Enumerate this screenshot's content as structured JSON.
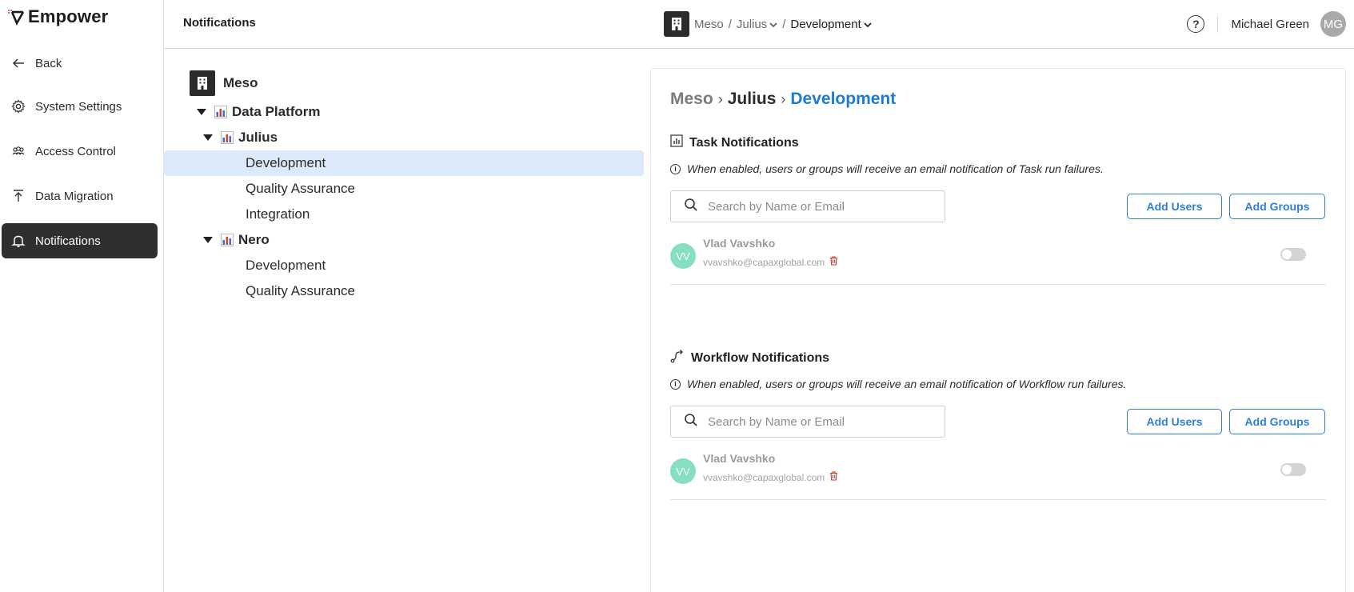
{
  "app": {
    "name": "Empower",
    "brand_color": "#2f2f2f",
    "accent_color": "#1f7ad1"
  },
  "sidebar": {
    "items": [
      {
        "label": "Back",
        "icon": "arrow-left-icon",
        "active": false
      },
      {
        "label": "System Settings",
        "icon": "gear-icon",
        "active": false
      },
      {
        "label": "Access Control",
        "icon": "people-icon",
        "active": false
      },
      {
        "label": "Data Migration",
        "icon": "upload-icon",
        "active": false
      },
      {
        "label": "Notifications",
        "icon": "bell-icon",
        "active": true
      }
    ]
  },
  "header": {
    "title": "Notifications",
    "crumb": {
      "org": "Meso",
      "sep1": "/",
      "project": "Julius",
      "sep2": "/",
      "env": "Development"
    },
    "user": {
      "name": "Michael Green",
      "initials": "MG"
    }
  },
  "tree": {
    "root": "Meso",
    "nodes": [
      {
        "label": "Data Platform"
      },
      {
        "label": "Julius"
      },
      {
        "label": "Development",
        "selected": true
      },
      {
        "label": "Quality Assurance"
      },
      {
        "label": "Integration"
      },
      {
        "label": "Nero"
      },
      {
        "label": "Development"
      },
      {
        "label": "Quality Assurance"
      }
    ]
  },
  "main": {
    "breadcrumb": {
      "org": "Meso",
      "project": "Julius",
      "env": "Development"
    },
    "task": {
      "title": "Task Notifications",
      "info": "When enabled, users or groups will receive an email notification of Task run failures.",
      "search_placeholder": "Search by Name or Email",
      "add_users": "Add Users",
      "add_groups": "Add Groups",
      "member": {
        "initials": "VV",
        "name": "Vlad Vavshko",
        "email": "vvavshko@capaxglobal.com",
        "enabled": false
      }
    },
    "workflow": {
      "title": "Workflow Notifications",
      "info": "When enabled, users or groups will receive an email notification of Workflow run failures.",
      "search_placeholder": "Search by Name or Email",
      "add_users": "Add Users",
      "add_groups": "Add Groups",
      "member": {
        "initials": "VV",
        "name": "Vlad Vavshko",
        "email": "vvavshko@capaxglobal.com",
        "enabled": false
      }
    }
  }
}
